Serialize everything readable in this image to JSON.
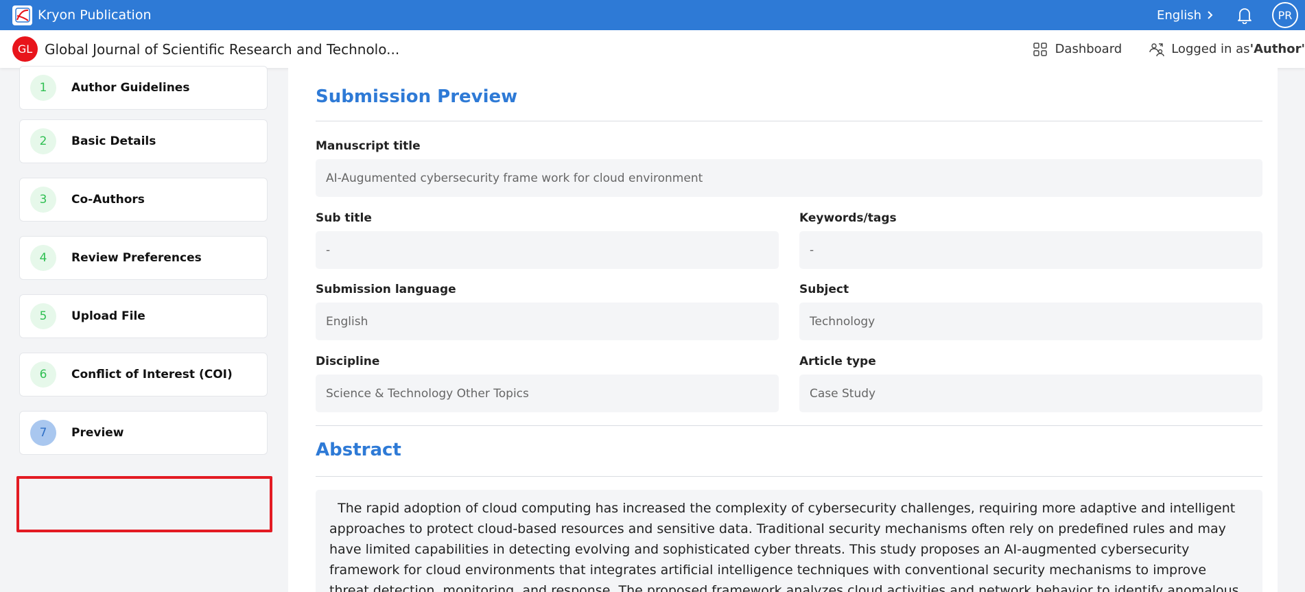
{
  "topbar": {
    "brand_name": "Kryon Publication",
    "language": "English",
    "avatar_initials": "PR",
    "color": "#2e7ad6"
  },
  "subheader": {
    "journal_initials": "GL",
    "journal_title": "Global Journal of Scientific Research and Technolo...",
    "dashboard_label": "Dashboard",
    "logged_in_prefix": "Logged in as ",
    "logged_in_role": "'Author'"
  },
  "steps": [
    {
      "num": "1",
      "label": "Author Guidelines"
    },
    {
      "num": "2",
      "label": "Basic Details"
    },
    {
      "num": "3",
      "label": "Co-Authors"
    },
    {
      "num": "4",
      "label": "Review Preferences"
    },
    {
      "num": "5",
      "label": "Upload File"
    },
    {
      "num": "6",
      "label": "Conflict of Interest (COI)"
    },
    {
      "num": "7",
      "label": "Preview"
    }
  ],
  "preview": {
    "title": "Submission Preview",
    "manuscript_title_label": "Manuscript title",
    "manuscript_title_value": "AI-Augumented cybersecurity frame work for cloud environment",
    "subtitle_label": "Sub title",
    "subtitle_value": "-",
    "keywords_label": "Keywords/tags",
    "keywords_value": "-",
    "language_label": "Submission language",
    "language_value": "English",
    "subject_label": "Subject",
    "subject_value": "Technology",
    "discipline_label": "Discipline",
    "discipline_value": "Science & Technology Other Topics",
    "article_type_label": "Article type",
    "article_type_value": "Case Study"
  },
  "abstract": {
    "title": "Abstract",
    "text": "  The rapid adoption of cloud computing has increased the complexity of cybersecurity challenges, requiring more adaptive and intelligent approaches to protect cloud-based resources and sensitive data. Traditional security mechanisms often rely on predefined rules and may have limited capabilities in detecting evolving and sophisticated cyber threats. This study proposes an AI-augmented cybersecurity framework for cloud environments that integrates artificial intelligence techniques with conventional security mechanisms to improve threat detection, monitoring, and response. The proposed framework analyzes cloud activities and network behavior to identify anomalous patterns and"
  }
}
